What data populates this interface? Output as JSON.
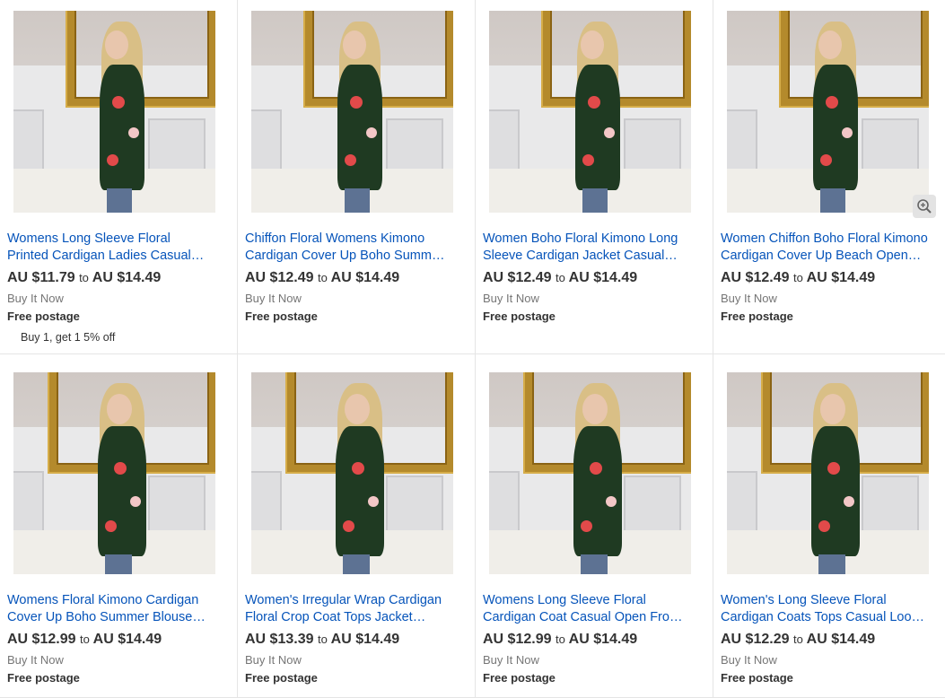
{
  "listings": [
    {
      "title_line1": "Womens Long Sleeve Floral",
      "title_line2": "Printed Cardigan Ladies Casual…",
      "price_low": "AU $11.79",
      "to": "to",
      "price_high": "AU $14.49",
      "buy": "Buy It Now",
      "shipping": "Free postage",
      "promo": "Buy 1, get 1 5% off"
    },
    {
      "title_line1": "Chiffon Floral Womens Kimono",
      "title_line2": "Cardigan Cover Up Boho Summe…",
      "price_low": "AU $12.49",
      "to": "to",
      "price_high": "AU $14.49",
      "buy": "Buy It Now",
      "shipping": "Free postage"
    },
    {
      "title_line1": "Women Boho Floral Kimono Long",
      "title_line2": "Sleeve Cardigan Jacket Casual…",
      "price_low": "AU $12.49",
      "to": "to",
      "price_high": "AU $14.49",
      "buy": "Buy It Now",
      "shipping": "Free postage"
    },
    {
      "title_line1": "Women Chiffon Boho Floral Kimono",
      "title_line2": "Cardigan Cover Up Beach Open…",
      "price_low": "AU $12.49",
      "to": "to",
      "price_high": "AU $14.49",
      "buy": "Buy It Now",
      "shipping": "Free postage"
    },
    {
      "title_line1": "Womens Floral Kimono Cardigan",
      "title_line2": "Cover Up Boho Summer Blouse…",
      "price_low": "AU $12.99",
      "to": "to",
      "price_high": "AU $14.49",
      "buy": "Buy It Now",
      "shipping": "Free postage"
    },
    {
      "title_line1": "Women's Irregular Wrap Cardigan",
      "title_line2": "Floral Crop Coat Tops Jacket…",
      "price_low": "AU $13.39",
      "to": "to",
      "price_high": "AU $14.49",
      "buy": "Buy It Now",
      "shipping": "Free postage"
    },
    {
      "title_line1": "Womens Long Sleeve Floral",
      "title_line2": "Cardigan Coat Casual Open Fron…",
      "price_low": "AU $12.99",
      "to": "to",
      "price_high": "AU $14.49",
      "buy": "Buy It Now",
      "shipping": "Free postage"
    },
    {
      "title_line1": "Women's Long Sleeve Floral",
      "title_line2": "Cardigan Coats Tops Casual Loo…",
      "price_low": "AU $12.29",
      "to": "to",
      "price_high": "AU $14.49",
      "buy": "Buy It Now",
      "shipping": "Free postage"
    }
  ],
  "icons": {
    "zoom": "zoom-in-icon"
  },
  "colors": {
    "link": "#0654ba",
    "frame": "#b48a2c",
    "cardigan": "#1f3a22"
  }
}
